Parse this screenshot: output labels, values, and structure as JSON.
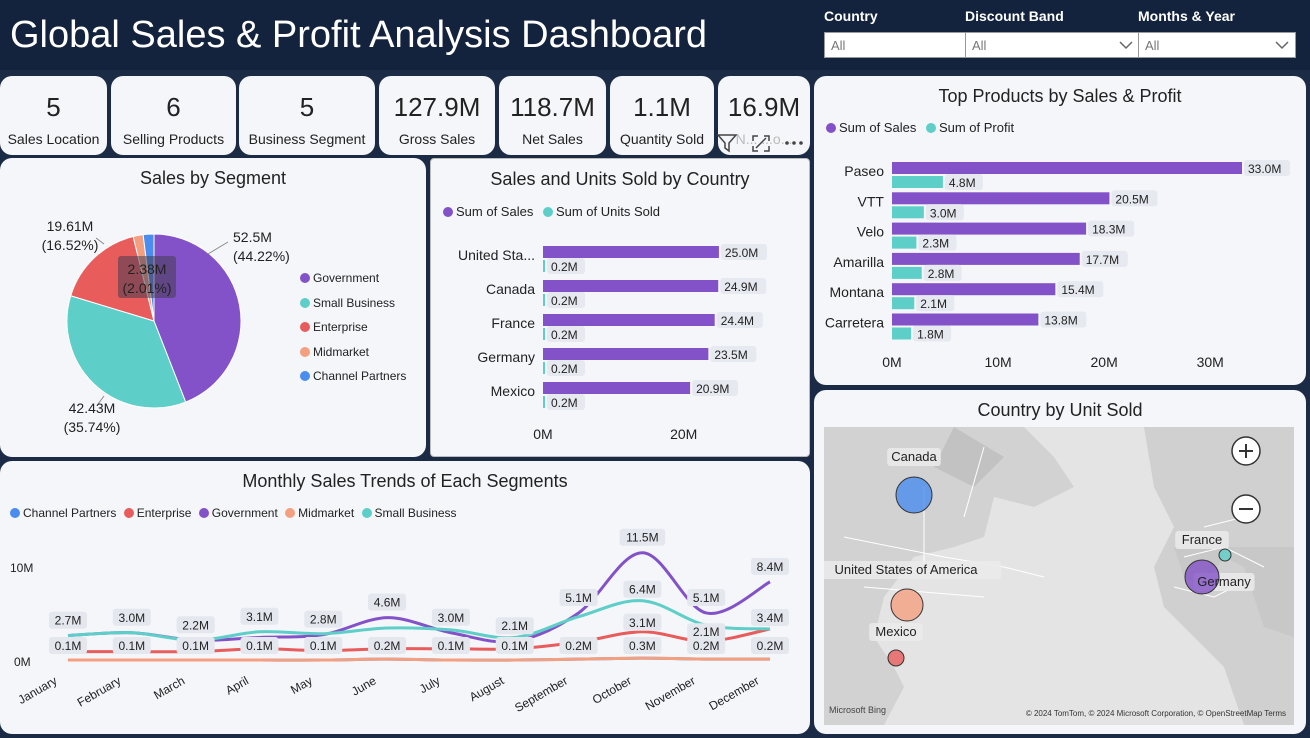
{
  "header": {
    "title": "Global Sales & Profit Analysis Dashboard",
    "filters": [
      {
        "label": "Country",
        "value": "All"
      },
      {
        "label": "Discount Band",
        "value": "All"
      },
      {
        "label": "Months & Year",
        "value": "All"
      }
    ]
  },
  "kpis": [
    {
      "value": "5",
      "label": "Sales Location"
    },
    {
      "value": "6",
      "label": "Selling Products"
    },
    {
      "value": "5",
      "label": "Business Segment"
    },
    {
      "value": "127.9M",
      "label": "Gross Sales"
    },
    {
      "value": "118.7M",
      "label": "Net Sales"
    },
    {
      "value": "1.1M",
      "label": "Quantity Sold"
    },
    {
      "value": "16.9M",
      "label": "N... ...o..."
    }
  ],
  "colors": {
    "government": "#8352c8",
    "small_business": "#5ecec8",
    "enterprise": "#e85c5c",
    "midmarket": "#f4a080",
    "channel_partners": "#4a8cef",
    "sales": "#8352c8",
    "units": "#5ecec8"
  },
  "icons": [
    "filter-icon",
    "focus-mode-icon",
    "more-options-icon",
    "zoom-in-icon",
    "zoom-out-icon"
  ],
  "chart_data": [
    {
      "id": "segment",
      "type": "pie",
      "title": "Sales by Segment",
      "slices": [
        {
          "name": "Government",
          "value": 52.5,
          "label": "52.5M",
          "pct": "(44.22%)"
        },
        {
          "name": "Small Business",
          "value": 42.43,
          "label": "42.43M",
          "pct": "(35.74%)"
        },
        {
          "name": "Enterprise",
          "value": 19.61,
          "label": "19.61M",
          "pct": "(16.52%)"
        },
        {
          "name": "Midmarket",
          "value": 2.21,
          "label": "",
          "pct": ""
        },
        {
          "name": "Channel Partners",
          "value": 2.38,
          "label": "2.38M",
          "pct": "(2.01%)"
        }
      ],
      "legend": [
        "Government",
        "Small Business",
        "Enterprise",
        "Midmarket",
        "Channel Partners"
      ]
    },
    {
      "id": "country",
      "type": "bar",
      "title": "Sales and Units Sold by Country",
      "series_names": [
        "Sum of  Sales",
        "Sum of Units Sold"
      ],
      "categories": [
        "United Sta...",
        "Canada",
        "France",
        "Germany",
        "Mexico"
      ],
      "series": [
        {
          "name": "Sum of  Sales",
          "values": [
            25.0,
            24.9,
            24.4,
            23.5,
            20.9
          ],
          "labels": [
            "25.0M",
            "24.9M",
            "24.4M",
            "23.5M",
            "20.9M"
          ]
        },
        {
          "name": "Sum of Units Sold",
          "values": [
            0.2,
            0.2,
            0.2,
            0.2,
            0.2
          ],
          "labels": [
            "0.2M",
            "0.2M",
            "0.2M",
            "0.2M",
            "0.2M"
          ]
        }
      ],
      "xticks": [
        "0M",
        "20M"
      ],
      "xlim": [
        0,
        27
      ]
    },
    {
      "id": "products",
      "type": "bar",
      "title": "Top Products by Sales & Profit",
      "series_names": [
        "Sum of  Sales",
        "Sum of Profit"
      ],
      "categories": [
        "Paseo",
        "VTT",
        "Velo",
        "Amarilla",
        "Montana",
        "Carretera"
      ],
      "series": [
        {
          "name": "Sum of  Sales",
          "values": [
            33.0,
            20.5,
            18.3,
            17.7,
            15.4,
            13.8
          ],
          "labels": [
            "33.0M",
            "20.5M",
            "18.3M",
            "17.7M",
            "15.4M",
            "13.8M"
          ]
        },
        {
          "name": "Sum of Profit",
          "values": [
            4.8,
            3.0,
            2.3,
            2.8,
            2.1,
            1.8
          ],
          "labels": [
            "4.8M",
            "3.0M",
            "2.3M",
            "2.8M",
            "2.1M",
            "1.8M"
          ]
        }
      ],
      "xticks": [
        "0M",
        "10M",
        "20M",
        "30M"
      ],
      "xlim": [
        0,
        33
      ]
    },
    {
      "id": "monthly",
      "type": "line",
      "title": "Monthly Sales Trends of Each Segments",
      "x": [
        "January",
        "February",
        "March",
        "April",
        "May",
        "June",
        "July",
        "August",
        "September",
        "October",
        "November",
        "December"
      ],
      "legend": [
        "Channel Partners",
        "Enterprise",
        "Government",
        "Midmarket",
        "Small Business"
      ],
      "yticks": [
        "10M",
        "0M"
      ],
      "ylim": [
        0,
        12
      ],
      "series": [
        {
          "name": "Channel Partners",
          "values": [
            0.1,
            0.1,
            0.1,
            0.1,
            0.1,
            0.2,
            0.1,
            0.1,
            0.2,
            0.3,
            0.2,
            0.2
          ]
        },
        {
          "name": "Enterprise",
          "values": [
            1.0,
            1.0,
            1.0,
            1.3,
            1.1,
            1.3,
            1.3,
            1.3,
            2.0,
            3.1,
            2.1,
            3.4
          ]
        },
        {
          "name": "Government",
          "values": [
            2.7,
            3.0,
            2.2,
            2.5,
            2.8,
            4.6,
            3.0,
            2.1,
            5.1,
            11.5,
            5.1,
            8.4
          ]
        },
        {
          "name": "Midmarket",
          "values": [
            0.1,
            0.1,
            0.1,
            0.1,
            0.1,
            0.2,
            0.1,
            0.1,
            0.2,
            0.3,
            0.2,
            0.2
          ]
        },
        {
          "name": "Small Business",
          "values": [
            2.7,
            3.0,
            2.2,
            3.1,
            2.9,
            3.5,
            3.3,
            2.5,
            4.7,
            6.4,
            3.8,
            3.4
          ]
        }
      ],
      "top_labels": [
        "2.7M",
        "3.0M",
        "2.2M",
        "3.1M",
        "2.8M",
        "4.6M",
        "3.0M",
        "2.1M",
        "5.1M",
        "11.5M",
        "5.1M",
        "8.4M"
      ],
      "top_values": [
        2.7,
        3.0,
        2.2,
        3.1,
        2.8,
        4.6,
        3.0,
        2.1,
        5.1,
        11.5,
        5.1,
        8.4
      ],
      "mid_labels": [
        "",
        "",
        "",
        "",
        "",
        "",
        "",
        "",
        "",
        "6.4M",
        "",
        "3.4M"
      ],
      "mid_values": [
        0,
        0,
        0,
        0,
        0,
        0,
        0,
        0,
        0,
        6.4,
        0,
        3.4
      ],
      "low_labels": [
        "",
        "",
        "",
        "",
        "",
        "",
        "",
        "",
        "",
        "3.1M",
        "2.1M",
        ""
      ],
      "low_values": [
        0,
        0,
        0,
        0,
        0,
        0,
        0,
        0,
        0,
        3.1,
        2.1,
        0
      ],
      "bottom_labels": [
        "0.1M",
        "0.1M",
        "0.1M",
        "0.1M",
        "0.1M",
        "0.2M",
        "0.1M",
        "0.1M",
        "0.2M",
        "0.3M",
        "0.2M",
        "0.2M"
      ]
    },
    {
      "id": "map",
      "type": "scatter",
      "title": "Country by Unit Sold",
      "points": [
        {
          "name": "Canada",
          "color": "#4a8cef"
        },
        {
          "name": "United States of America",
          "color": "#f4a080"
        },
        {
          "name": "Mexico",
          "color": "#e85c5c"
        },
        {
          "name": "France",
          "color": "#5ecec8"
        },
        {
          "name": "Germany",
          "color": "#8352c8"
        }
      ],
      "attribution": "© 2024 TomTom, © 2024 Microsoft Corporation, © OpenStreetMap  Terms",
      "brand": "Microsoft Bing"
    }
  ]
}
